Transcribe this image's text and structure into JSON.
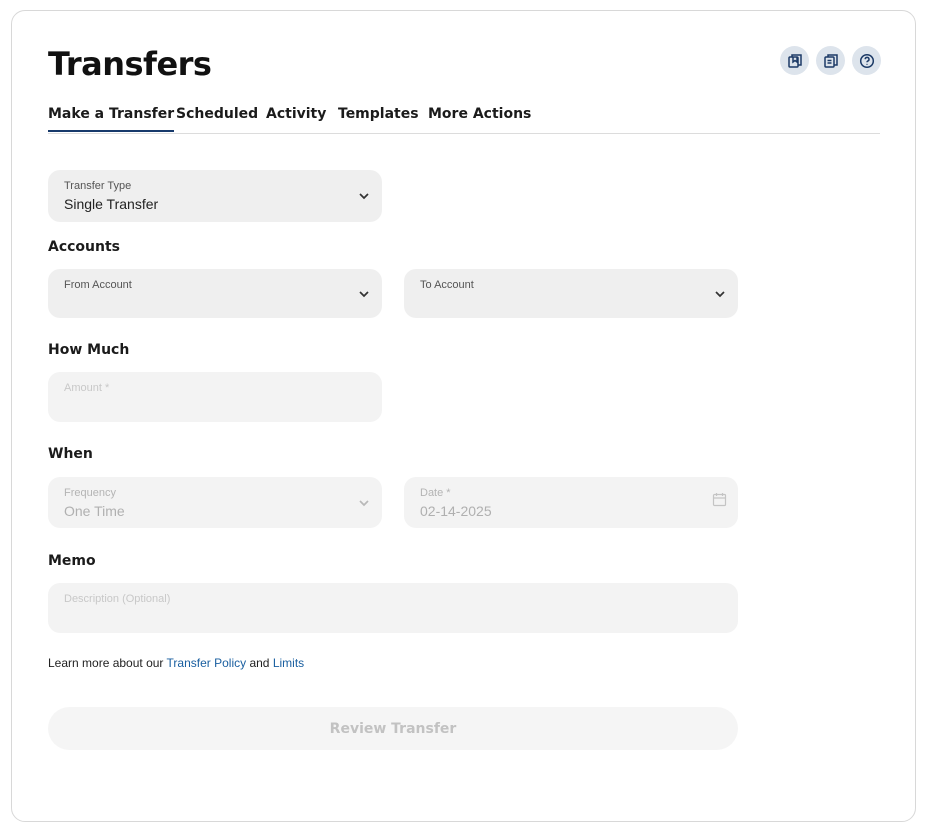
{
  "header": {
    "title": "Transfers",
    "icons": [
      "bookmark-icon",
      "document-list-icon",
      "help-icon"
    ]
  },
  "tabs": [
    {
      "label": "Make a Transfer",
      "active": true
    },
    {
      "label": "Scheduled",
      "active": false
    },
    {
      "label": "Activity",
      "active": false
    },
    {
      "label": "Templates",
      "active": false
    },
    {
      "label": "More Actions",
      "active": false
    }
  ],
  "form": {
    "transfer_type": {
      "label": "Transfer Type",
      "value": "Single Transfer"
    },
    "accounts_heading": "Accounts",
    "from_account": {
      "label": "From Account",
      "value": ""
    },
    "to_account": {
      "label": "To Account",
      "value": ""
    },
    "how_much_heading": "How Much",
    "amount": {
      "label": "Amount  *",
      "value": ""
    },
    "when_heading": "When",
    "frequency": {
      "label": "Frequency",
      "value": "One Time"
    },
    "date": {
      "label": "Date  *",
      "value": "02-14-2025"
    },
    "memo_heading": "Memo",
    "description": {
      "label": "Description (Optional)",
      "value": ""
    }
  },
  "footer": {
    "note_prefix": "Learn more about our",
    "policy_link": "Transfer Policy",
    "and_text": "and",
    "limits_link": "Limits",
    "review_button": "Review Transfer"
  },
  "colors": {
    "accent": "#173a6b",
    "link": "#1a5fa0",
    "field_bg": "#efefef",
    "icon_button_bg": "#dde4ec"
  }
}
